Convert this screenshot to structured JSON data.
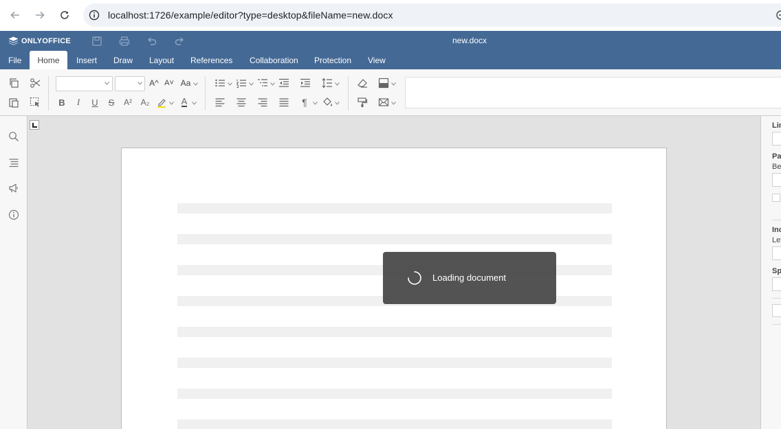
{
  "browser": {
    "url": "localhost:1726/example/editor?type=desktop&fileName=new.docx",
    "back_icon": "arrow-left-icon",
    "forward_icon": "arrow-right-icon",
    "reload_icon": "reload-icon",
    "site_info_icon": "info-icon"
  },
  "app": {
    "brand": "ONLYOFFICE",
    "document_title": "new.docx",
    "header_color": "#446995",
    "quick_access": [
      "save-icon",
      "print-icon",
      "undo-icon",
      "redo-icon"
    ]
  },
  "tabs": [
    {
      "label": "File",
      "active": false
    },
    {
      "label": "Home",
      "active": true
    },
    {
      "label": "Insert",
      "active": false
    },
    {
      "label": "Draw",
      "active": false
    },
    {
      "label": "Layout",
      "active": false
    },
    {
      "label": "References",
      "active": false
    },
    {
      "label": "Collaboration",
      "active": false
    },
    {
      "label": "Protection",
      "active": false
    },
    {
      "label": "View",
      "active": false
    }
  ],
  "toolbar": {
    "font_name": "",
    "font_size": "",
    "bold": "B",
    "italic": "I",
    "underline": "U",
    "strikethrough": "S",
    "superscript": "A²",
    "subscript": "A₂",
    "font_color": "A",
    "increase_font": "A^",
    "decrease_font": "A˅",
    "change_case": "Aa",
    "paragraph_mark": "¶"
  },
  "left_panel": [
    "search-icon",
    "navigation-icon",
    "feedback-icon",
    "about-icon"
  ],
  "right_panel": {
    "labels": [
      "Lin",
      "Pa",
      "Be",
      "Inc",
      "Lef",
      "Sp"
    ]
  },
  "loading": {
    "message": "Loading document"
  }
}
